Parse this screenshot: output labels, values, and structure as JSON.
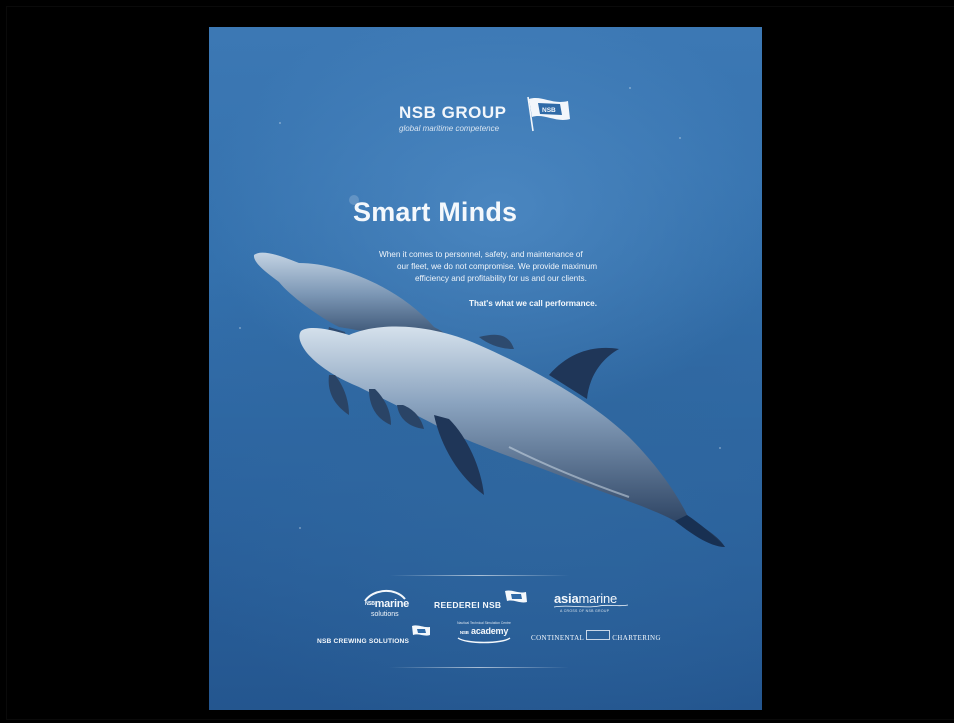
{
  "brand": {
    "name": "NSB GROUP",
    "tagline": "global maritime competence",
    "flag_text": "NSB"
  },
  "headline": "Smart Minds",
  "body": {
    "line1": "When it comes to personnel, safety, and maintenance of",
    "line2": "our fleet, we do not compromise. We provide maximum",
    "line3": "efficiency and profitability for us and our clients."
  },
  "tagline": "That's what we call performance.",
  "logos": {
    "marine_solutions": {
      "prefix": "NSB",
      "name": "marine",
      "sub": "solutions"
    },
    "reederei": {
      "name": "REEDEREI NSB"
    },
    "asiamarine": {
      "bold": "asia",
      "light": "marine",
      "sub": "A CROSS OF NSB GROUP"
    },
    "crewing": {
      "name": "NSB CREWING SOLUTIONS"
    },
    "academy": {
      "pre": "Nautical Technical Simulation Centre",
      "prefix": "NSB",
      "name": "academy"
    },
    "continental": {
      "left": "Continental",
      "right": "Chartering"
    }
  },
  "colors": {
    "background": "#000000",
    "ocean_top": "#3c78b4",
    "ocean_bottom": "#24568f",
    "text": "#f4f8fc"
  }
}
